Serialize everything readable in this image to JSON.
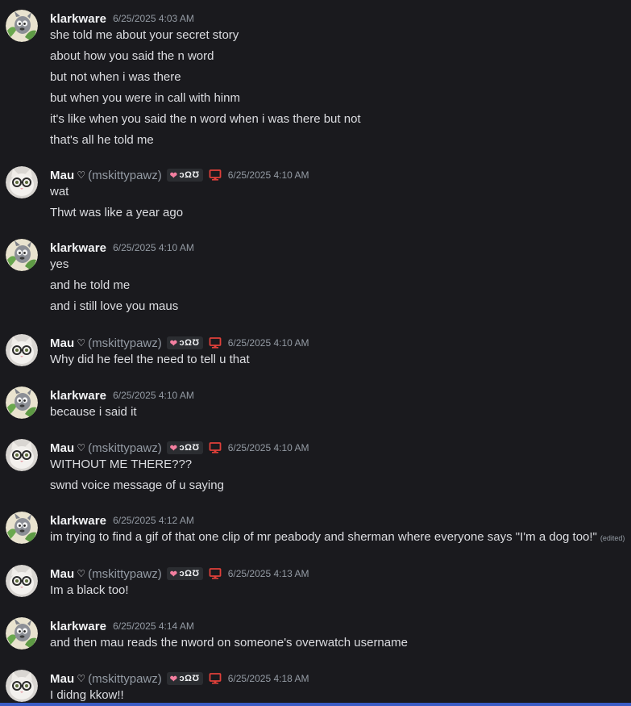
{
  "users": {
    "klark": {
      "name": "klarkware"
    },
    "mau": {
      "name": "Mau",
      "heart": "♡",
      "handle": "(mskittypawz)",
      "tag_heart": "❤",
      "tag_text": "ↄΩƱ"
    }
  },
  "colors": {
    "background": "#1a1a1e",
    "text": "#dcdde1",
    "muted": "#949ba4",
    "username": "#f2f3f5",
    "tag_heart": "#f47fa0",
    "monitor_icon": "#e0403a"
  },
  "messages": [
    {
      "user": "klarkware",
      "timestamp": "6/25/2025 4:03 AM",
      "lines": [
        "she told me about your secret story",
        "about how you said the n word",
        "but not when i was there",
        "but when you were in call with hinm",
        "it's like when you said the n word when i was there but not",
        "that's all he told me"
      ]
    },
    {
      "user": "Mau",
      "timestamp": "6/25/2025 4:10 AM",
      "lines": [
        "wat",
        "Thwt was like a year ago"
      ]
    },
    {
      "user": "klarkware",
      "timestamp": "6/25/2025 4:10 AM",
      "lines": [
        "yes",
        "and he told me",
        "and i still love you maus"
      ]
    },
    {
      "user": "Mau",
      "timestamp": "6/25/2025 4:10 AM",
      "lines": [
        "Why did he feel the need to tell u that"
      ]
    },
    {
      "user": "klarkware",
      "timestamp": "6/25/2025 4:10 AM",
      "lines": [
        "because i said it"
      ]
    },
    {
      "user": "Mau",
      "timestamp": "6/25/2025 4:10 AM",
      "lines": [
        "WITHOUT ME THERE???",
        "swnd voice message of u saying"
      ]
    },
    {
      "user": "klarkware",
      "timestamp": "6/25/2025 4:12 AM",
      "lines": [
        "im trying to find a gif of that one clip of mr peabody and sherman where everyone says \"I'm a dog too!\""
      ],
      "edited": "(edited)"
    },
    {
      "user": "Mau",
      "timestamp": "6/25/2025 4:13 AM",
      "lines": [
        "Im a black too!"
      ]
    },
    {
      "user": "klarkware",
      "timestamp": "6/25/2025 4:14 AM",
      "lines": [
        "and then mau reads the nword on someone's overwatch username"
      ]
    },
    {
      "user": "Mau",
      "timestamp": "6/25/2025 4:18 AM",
      "lines": [
        "I didng kkow!!"
      ]
    }
  ]
}
